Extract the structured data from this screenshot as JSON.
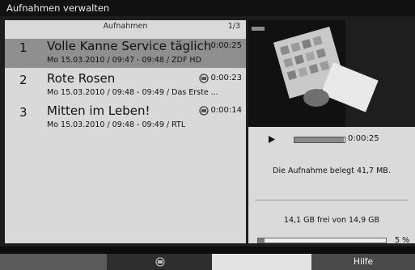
{
  "window": {
    "title": "Aufnahmen verwalten"
  },
  "list": {
    "header": "Aufnahmen",
    "page": "1/3",
    "items": [
      {
        "number": "1",
        "title": "Volle Kanne Service täglich",
        "duration": "0:00:25",
        "info": "Mo 15.03.2010  / 09:47 - 09:48  / ZDF HD",
        "selected": true
      },
      {
        "number": "2",
        "title": "Rote Rosen",
        "duration": "0:00:23",
        "info": "Mo 15.03.2010  / 09:48 - 09:49  / Das Erste ...",
        "icon": "recording-icon",
        "selected": false
      },
      {
        "number": "3",
        "title": "Mitten im Leben!",
        "duration": "0:00:14",
        "info": "Mo 15.03.2010  / 09:48 - 09:49  / RTL",
        "icon": "recording-icon",
        "selected": false
      }
    ]
  },
  "preview": {
    "play_icon": "play-icon",
    "progress_fraction": 0.98,
    "time": "0:00:25",
    "occupancy": "Die Aufnahme belegt 41,7 MB.",
    "space": "14,1 GB frei von 14,9 GB",
    "usage_percent": 5,
    "usage_label": "5 %"
  },
  "footer": {
    "buttons": [
      {
        "color": "#5a5a5a",
        "label": ""
      },
      {
        "color": "#2e2e2e",
        "label": "",
        "icon": "recording-icon"
      },
      {
        "color": "#e3e3e3",
        "label": ""
      },
      {
        "color": "#4a4a4a",
        "label": "Hilfe"
      }
    ]
  }
}
